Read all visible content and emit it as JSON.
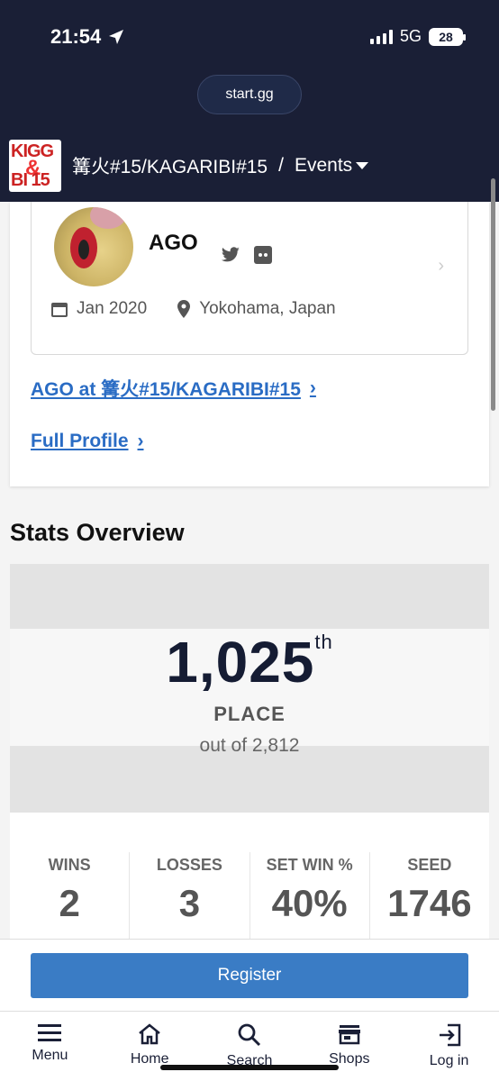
{
  "status_bar": {
    "time": "21:54",
    "network": "5G",
    "battery": "28"
  },
  "browser": {
    "url": "start.gg"
  },
  "event_header": {
    "logo_text_1": "KIGG",
    "logo_text_2": "&",
    "logo_text_3": "BI 15",
    "title": "篝火#15/KAGARIBI#15",
    "separator": "/",
    "section": "Events"
  },
  "profile": {
    "name": "AGO",
    "joined": "Jan 2020",
    "location": "Yokohama, Japan",
    "event_link": "AGO at 篝火#15/KAGARIBI#15",
    "full_profile": "Full Profile"
  },
  "stats": {
    "title": "Stats Overview",
    "place": "1,025",
    "place_suffix": "th",
    "place_label": "PLACE",
    "out_of": "out of 2,812",
    "columns": [
      {
        "label": "WINS",
        "value": "2"
      },
      {
        "label": "LOSSES",
        "value": "3"
      },
      {
        "label": "SET WIN %",
        "value": "40%"
      },
      {
        "label": "SEED",
        "value": "1746"
      }
    ]
  },
  "register_label": "Register",
  "nav": [
    {
      "label": "Menu",
      "icon": "menu-icon"
    },
    {
      "label": "Home",
      "icon": "home-icon"
    },
    {
      "label": "Search",
      "icon": "search-icon"
    },
    {
      "label": "Shops",
      "icon": "shop-icon"
    },
    {
      "label": "Log in",
      "icon": "login-icon"
    }
  ]
}
